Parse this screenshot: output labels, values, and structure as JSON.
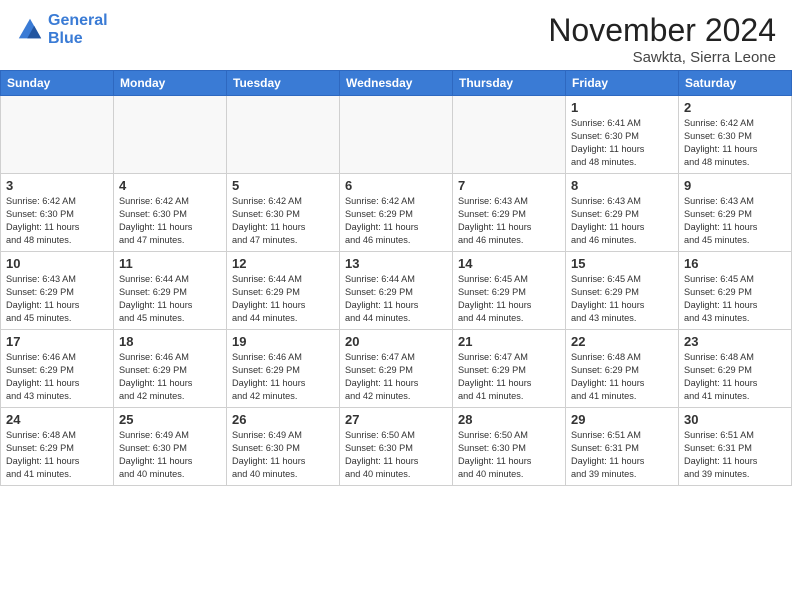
{
  "header": {
    "logo_line1": "General",
    "logo_line2": "Blue",
    "month": "November 2024",
    "location": "Sawkta, Sierra Leone"
  },
  "weekdays": [
    "Sunday",
    "Monday",
    "Tuesday",
    "Wednesday",
    "Thursday",
    "Friday",
    "Saturday"
  ],
  "weeks": [
    [
      {
        "day": "",
        "info": ""
      },
      {
        "day": "",
        "info": ""
      },
      {
        "day": "",
        "info": ""
      },
      {
        "day": "",
        "info": ""
      },
      {
        "day": "",
        "info": ""
      },
      {
        "day": "1",
        "info": "Sunrise: 6:41 AM\nSunset: 6:30 PM\nDaylight: 11 hours\nand 48 minutes."
      },
      {
        "day": "2",
        "info": "Sunrise: 6:42 AM\nSunset: 6:30 PM\nDaylight: 11 hours\nand 48 minutes."
      }
    ],
    [
      {
        "day": "3",
        "info": "Sunrise: 6:42 AM\nSunset: 6:30 PM\nDaylight: 11 hours\nand 48 minutes."
      },
      {
        "day": "4",
        "info": "Sunrise: 6:42 AM\nSunset: 6:30 PM\nDaylight: 11 hours\nand 47 minutes."
      },
      {
        "day": "5",
        "info": "Sunrise: 6:42 AM\nSunset: 6:30 PM\nDaylight: 11 hours\nand 47 minutes."
      },
      {
        "day": "6",
        "info": "Sunrise: 6:42 AM\nSunset: 6:29 PM\nDaylight: 11 hours\nand 46 minutes."
      },
      {
        "day": "7",
        "info": "Sunrise: 6:43 AM\nSunset: 6:29 PM\nDaylight: 11 hours\nand 46 minutes."
      },
      {
        "day": "8",
        "info": "Sunrise: 6:43 AM\nSunset: 6:29 PM\nDaylight: 11 hours\nand 46 minutes."
      },
      {
        "day": "9",
        "info": "Sunrise: 6:43 AM\nSunset: 6:29 PM\nDaylight: 11 hours\nand 45 minutes."
      }
    ],
    [
      {
        "day": "10",
        "info": "Sunrise: 6:43 AM\nSunset: 6:29 PM\nDaylight: 11 hours\nand 45 minutes."
      },
      {
        "day": "11",
        "info": "Sunrise: 6:44 AM\nSunset: 6:29 PM\nDaylight: 11 hours\nand 45 minutes."
      },
      {
        "day": "12",
        "info": "Sunrise: 6:44 AM\nSunset: 6:29 PM\nDaylight: 11 hours\nand 44 minutes."
      },
      {
        "day": "13",
        "info": "Sunrise: 6:44 AM\nSunset: 6:29 PM\nDaylight: 11 hours\nand 44 minutes."
      },
      {
        "day": "14",
        "info": "Sunrise: 6:45 AM\nSunset: 6:29 PM\nDaylight: 11 hours\nand 44 minutes."
      },
      {
        "day": "15",
        "info": "Sunrise: 6:45 AM\nSunset: 6:29 PM\nDaylight: 11 hours\nand 43 minutes."
      },
      {
        "day": "16",
        "info": "Sunrise: 6:45 AM\nSunset: 6:29 PM\nDaylight: 11 hours\nand 43 minutes."
      }
    ],
    [
      {
        "day": "17",
        "info": "Sunrise: 6:46 AM\nSunset: 6:29 PM\nDaylight: 11 hours\nand 43 minutes."
      },
      {
        "day": "18",
        "info": "Sunrise: 6:46 AM\nSunset: 6:29 PM\nDaylight: 11 hours\nand 42 minutes."
      },
      {
        "day": "19",
        "info": "Sunrise: 6:46 AM\nSunset: 6:29 PM\nDaylight: 11 hours\nand 42 minutes."
      },
      {
        "day": "20",
        "info": "Sunrise: 6:47 AM\nSunset: 6:29 PM\nDaylight: 11 hours\nand 42 minutes."
      },
      {
        "day": "21",
        "info": "Sunrise: 6:47 AM\nSunset: 6:29 PM\nDaylight: 11 hours\nand 41 minutes."
      },
      {
        "day": "22",
        "info": "Sunrise: 6:48 AM\nSunset: 6:29 PM\nDaylight: 11 hours\nand 41 minutes."
      },
      {
        "day": "23",
        "info": "Sunrise: 6:48 AM\nSunset: 6:29 PM\nDaylight: 11 hours\nand 41 minutes."
      }
    ],
    [
      {
        "day": "24",
        "info": "Sunrise: 6:48 AM\nSunset: 6:29 PM\nDaylight: 11 hours\nand 41 minutes."
      },
      {
        "day": "25",
        "info": "Sunrise: 6:49 AM\nSunset: 6:30 PM\nDaylight: 11 hours\nand 40 minutes."
      },
      {
        "day": "26",
        "info": "Sunrise: 6:49 AM\nSunset: 6:30 PM\nDaylight: 11 hours\nand 40 minutes."
      },
      {
        "day": "27",
        "info": "Sunrise: 6:50 AM\nSunset: 6:30 PM\nDaylight: 11 hours\nand 40 minutes."
      },
      {
        "day": "28",
        "info": "Sunrise: 6:50 AM\nSunset: 6:30 PM\nDaylight: 11 hours\nand 40 minutes."
      },
      {
        "day": "29",
        "info": "Sunrise: 6:51 AM\nSunset: 6:31 PM\nDaylight: 11 hours\nand 39 minutes."
      },
      {
        "day": "30",
        "info": "Sunrise: 6:51 AM\nSunset: 6:31 PM\nDaylight: 11 hours\nand 39 minutes."
      }
    ]
  ]
}
